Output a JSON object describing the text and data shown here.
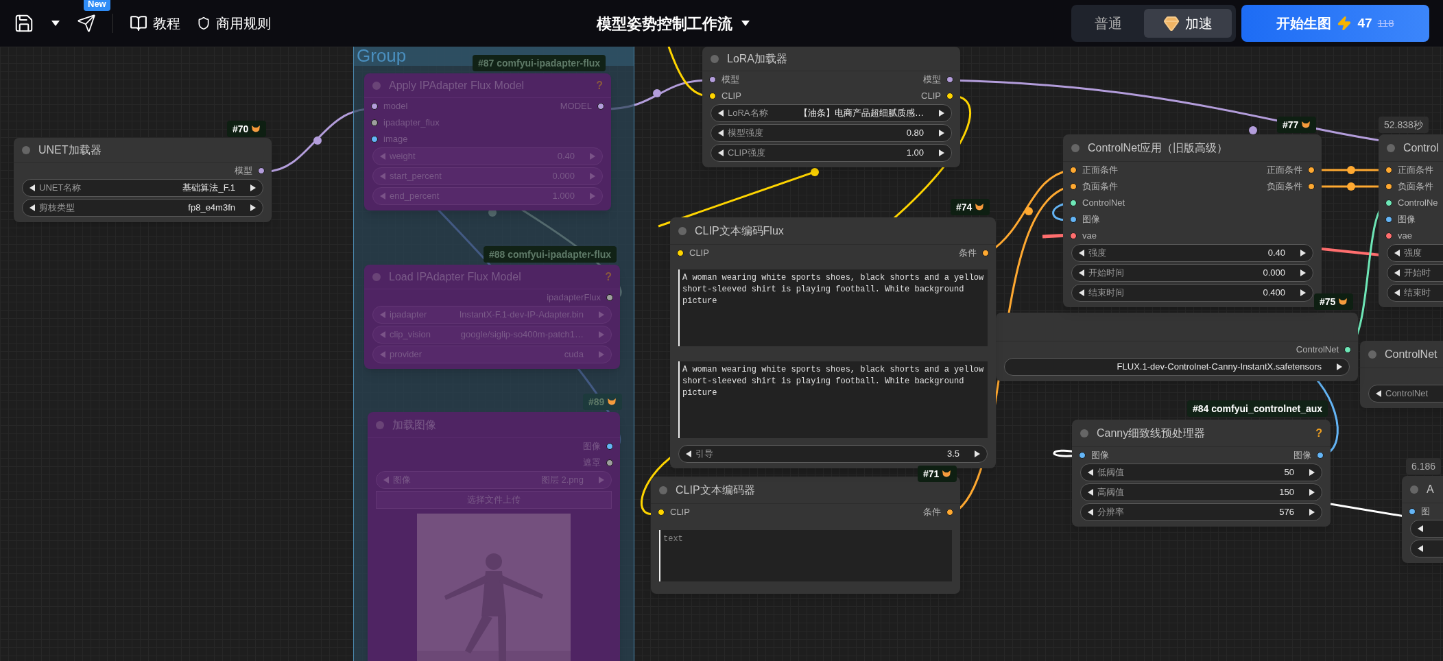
{
  "toolbar": {
    "new_badge": "New",
    "links": [
      {
        "label": "教程"
      },
      {
        "label": "商用规则"
      }
    ],
    "title": "模型姿势控制工作流",
    "modes": [
      {
        "label": "普通",
        "selected": false
      },
      {
        "label": "加速",
        "selected": true
      }
    ],
    "run_button": {
      "label": "开始生图",
      "credits": "47",
      "original_credits": "118"
    }
  },
  "canvas": {
    "group": {
      "title": "Group"
    },
    "badges": [
      {
        "text": "#70",
        "kind": "id",
        "dimmed": false
      },
      {
        "text": "#87 comfyui-ipadapter-flux",
        "kind": "pack",
        "dimmed": true
      },
      {
        "text": "#88 comfyui-ipadapter-flux",
        "kind": "pack",
        "dimmed": true
      },
      {
        "text": "#89",
        "kind": "id",
        "dimmed": true
      },
      {
        "text": "#74",
        "kind": "id",
        "dimmed": false
      },
      {
        "text": "#71",
        "kind": "id",
        "dimmed": false
      },
      {
        "text": "#77",
        "kind": "id",
        "dimmed": false
      },
      {
        "text": "#75",
        "kind": "id",
        "dimmed": false
      },
      {
        "text": "#84 comfyui_controlnet_aux",
        "kind": "pack",
        "dimmed": false
      },
      {
        "text": "52.838秒",
        "kind": "time"
      },
      {
        "text": "6.186",
        "kind": "time"
      }
    ],
    "nodes": [
      {
        "title": "UNET加载器",
        "bypassed": false,
        "outputs": [
          {
            "label": "模型",
            "color": "#b39ddb"
          }
        ],
        "widgets": [
          {
            "label": "UNET名称",
            "value": "基础算法_F.1"
          },
          {
            "label": "剪枝类型",
            "value": "fp8_e4m3fn"
          }
        ]
      },
      {
        "title": "Apply IPAdapter Flux Model",
        "bypassed": true,
        "help": "?",
        "inputs": [
          {
            "label": "model",
            "color": "#b39ddb"
          },
          {
            "label": "ipadapter_flux",
            "color": "#9e9e9e"
          },
          {
            "label": "image",
            "color": "#64b5f6"
          }
        ],
        "outputs": [
          {
            "label": "MODEL",
            "color": "#b39ddb"
          }
        ],
        "widgets": [
          {
            "label": "weight",
            "value": "0.40"
          },
          {
            "label": "start_percent",
            "value": "0.000"
          },
          {
            "label": "end_percent",
            "value": "1.000"
          }
        ]
      },
      {
        "title": "Load IPAdapter Flux Model",
        "bypassed": true,
        "help": "?",
        "outputs": [
          {
            "label": "ipadapterFlux",
            "color": "#9e9e9e"
          }
        ],
        "widgets": [
          {
            "label": "ipadapter",
            "value": "InstantX-F.1-dev-IP-Adapter.bin"
          },
          {
            "label": "clip_vision",
            "value": "google/siglip-so400m-patch1…"
          },
          {
            "label": "provider",
            "value": "cuda"
          }
        ]
      },
      {
        "title": "加载图像",
        "bypassed": true,
        "outputs": [
          {
            "label": "图像",
            "color": "#64b5f6"
          },
          {
            "label": "遮罩",
            "color": "#9e9e9e"
          }
        ],
        "widgets": [
          {
            "label": "图像",
            "value": "图层 2.png"
          }
        ],
        "upload": "选择文件上传",
        "preview": {
          "kind": "picture"
        }
      },
      {
        "title": "LoRA加载器",
        "bypassed": false,
        "inputs": [
          {
            "label": "模型",
            "color": "#b39ddb"
          },
          {
            "label": "CLIP",
            "color": "#ffd500"
          }
        ],
        "outputs": [
          {
            "label": "模型",
            "color": "#b39ddb"
          },
          {
            "label": "CLIP",
            "color": "#ffd500"
          }
        ],
        "widgets": [
          {
            "label": "LoRA名称",
            "value": "【油条】电商产品超细腻质感…"
          },
          {
            "label": "模型强度",
            "value": "0.80"
          },
          {
            "label": "CLIP强度",
            "value": "1.00"
          }
        ]
      },
      {
        "title": "CLIP文本编码Flux",
        "bypassed": false,
        "inputs": [
          {
            "label": "CLIP",
            "color": "#ffd500"
          }
        ],
        "outputs": [
          {
            "label": "条件",
            "color": "#ffa931"
          }
        ],
        "textareas": [
          {
            "value": "A woman wearing white sports shoes, black shorts and a yellow short-sleeved shirt is playing football. White background picture"
          },
          {
            "value": "A woman wearing white sports shoes, black shorts and a yellow short-sleeved shirt is playing football. White background picture"
          }
        ],
        "widgets": [
          {
            "label": "引导",
            "value": "3.5"
          }
        ]
      },
      {
        "title": "CLIP文本编码器",
        "bypassed": false,
        "inputs": [
          {
            "label": "CLIP",
            "color": "#ffd500"
          }
        ],
        "outputs": [
          {
            "label": "条件",
            "color": "#ffa931"
          }
        ],
        "textareas": [
          {
            "placeholder": "text"
          }
        ]
      },
      {
        "bypassed": false,
        "outputs": [
          {
            "label": "ControlNet",
            "color": "#6ee7b7"
          }
        ],
        "widgets": [
          {
            "value": "FLUX.1-dev-Controlnet-Canny-InstantX.safetensors"
          }
        ]
      },
      {
        "title": "ControlNet应用（旧版高级）",
        "bypassed": false,
        "inputs": [
          {
            "label": "正面条件",
            "color": "#ffa931"
          },
          {
            "label": "负面条件",
            "color": "#ffa931"
          },
          {
            "label": "ControlNet",
            "color": "#6ee7b7"
          },
          {
            "label": "图像",
            "color": "#64b5f6"
          },
          {
            "label": "vae",
            "color": "#ff6e6e"
          }
        ],
        "outputs": [
          {
            "label": "正面条件",
            "color": "#ffa931"
          },
          {
            "label": "负面条件",
            "color": "#ffa931"
          }
        ],
        "widgets": [
          {
            "label": "强度",
            "value": "0.40"
          },
          {
            "label": "开始时间",
            "value": "0.000"
          },
          {
            "label": "结束时间",
            "value": "0.400"
          }
        ]
      },
      {
        "title": "Canny细致线预处理器",
        "bypassed": false,
        "help": "?",
        "inputs": [
          {
            "label": "图像",
            "color": "#64b5f6"
          }
        ],
        "outputs": [
          {
            "label": "图像",
            "color": "#64b5f6"
          }
        ],
        "widgets": [
          {
            "label": "低阈值",
            "value": "50"
          },
          {
            "label": "高阈值",
            "value": "150"
          },
          {
            "label": "分辨率",
            "value": "576"
          }
        ]
      },
      {
        "title": "Control",
        "bypassed": false,
        "inputs": [
          {
            "label": "正面条件",
            "color": "#ffa931"
          },
          {
            "label": "负面条件",
            "color": "#ffa931"
          },
          {
            "label": "ControlNe",
            "color": "#6ee7b7"
          },
          {
            "label": "图像",
            "color": "#64b5f6"
          },
          {
            "label": "vae",
            "color": "#ff6e6e"
          }
        ],
        "widgets": [
          {
            "label": "强度"
          },
          {
            "label": "开始时"
          },
          {
            "label": "结束时"
          }
        ]
      },
      {
        "title": "ControlNet",
        "bypassed": false,
        "widgets": [
          {
            "label": "ControlNet"
          }
        ]
      },
      {
        "title": "A",
        "bypassed": false,
        "inputs": [
          {
            "label": "图",
            "color": "#64b5f6"
          }
        ],
        "widgets": [
          {
            "kind": "stepper"
          },
          {
            "kind": "stepper"
          }
        ]
      }
    ]
  }
}
